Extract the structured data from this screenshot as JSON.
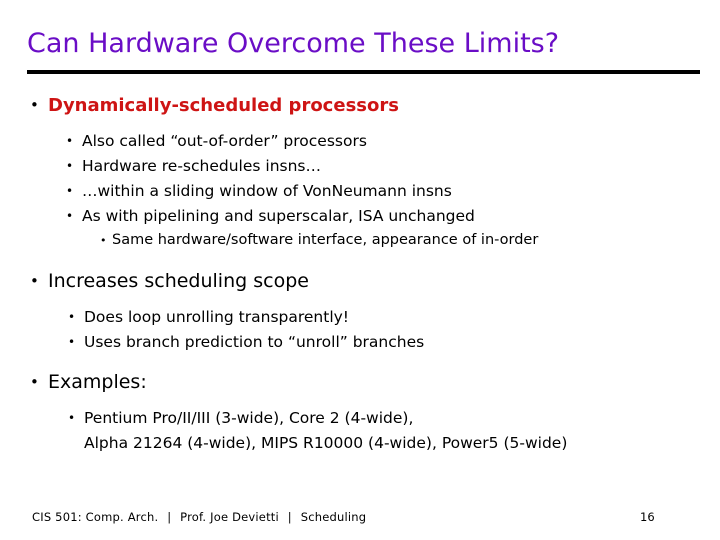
{
  "slide": {
    "title": "Can Hardware Overcome These Limits?",
    "title_color": "#6A0DC6",
    "rule_color": "#000000",
    "accent_red": "#CE1414",
    "background": "#ffffff",
    "bullet_glyph": "•"
  },
  "content": [
    {
      "level": 1,
      "emphasis": "red-bold",
      "text": "Dynamically-scheduled processors"
    },
    {
      "level": 2,
      "text": "Also called “out-of-order” processors"
    },
    {
      "level": 2,
      "text": "Hardware re-schedules insns…"
    },
    {
      "level": 2,
      "text": "…within a sliding window of Von​Neumann insns"
    },
    {
      "level": 2,
      "text": "As with pipelining and superscalar, ISA unchanged"
    },
    {
      "level": 3,
      "text": "Same hardware/software interface, appearance of in-order"
    },
    {
      "level": 1,
      "text": "Increases scheduling scope"
    },
    {
      "level": 2,
      "text": "Does loop unrolling transparently!"
    },
    {
      "level": 2,
      "text": "Uses branch prediction to “unroll” branches"
    },
    {
      "level": 1,
      "text": "Examples:"
    },
    {
      "level": 2,
      "text_line1": "Pentium Pro/II/III (3-wide), Core 2 (4-wide),",
      "text_line2": "Alpha 21264 (4-wide), MIPS R10000 (4-wide), Power5 (5-wide)"
    }
  ],
  "footer": {
    "course": "CIS 501: Comp. Arch.",
    "separator": "|",
    "instructor": "Prof. Joe Devietti",
    "topic": "Scheduling",
    "page_number": "16"
  }
}
